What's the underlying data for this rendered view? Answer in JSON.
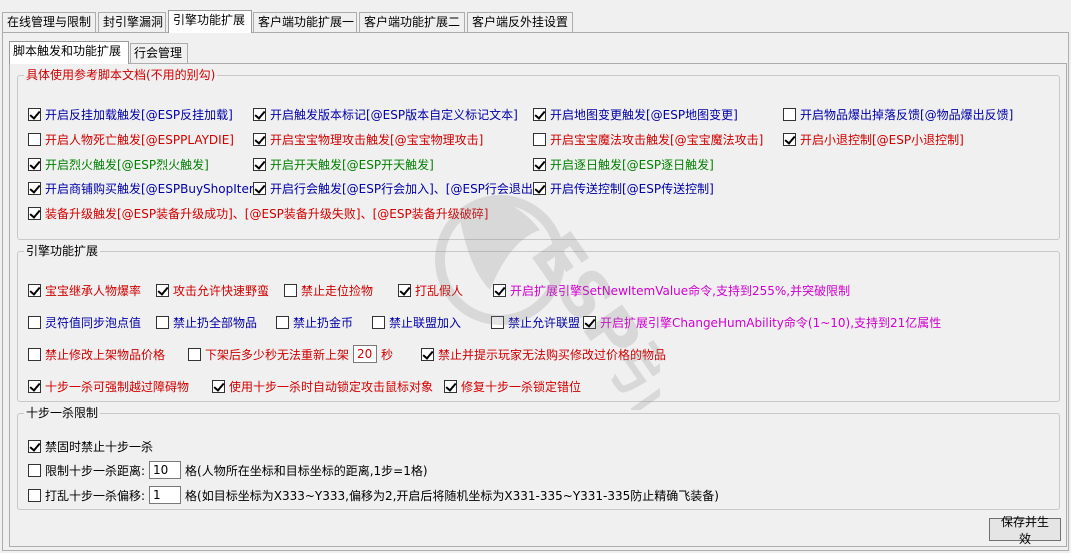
{
  "top_tabs": [
    "在线管理与限制",
    "封引擎漏洞",
    "引擎功能扩展",
    "客户端功能扩展一",
    "客户端功能扩展二",
    "客户端反外挂设置"
  ],
  "sub_tabs": [
    "脚本触发和功能扩展",
    "行会管理"
  ],
  "group1": {
    "title": "具体使用参考脚本文档(不用的别勾)",
    "items": [
      {
        "label": "开启反挂加载触发[@ESP反挂加载]",
        "checked": true,
        "color": "blue"
      },
      {
        "label": "开启触发版本标记[@ESP版本自定义标记文本]",
        "checked": true,
        "color": "blue"
      },
      {
        "label": "开启地图变更触发[@ESP地图变更]",
        "checked": true,
        "color": "blue"
      },
      {
        "label": "开启物品爆出掉落反馈[@物品爆出反馈]",
        "checked": false,
        "color": "blue"
      },
      {
        "label": "开启人物死亡触发[@ESPPLAYDIE]",
        "checked": false,
        "color": "red"
      },
      {
        "label": "开启宝宝物理攻击触发[@宝宝物理攻击]",
        "checked": true,
        "color": "red"
      },
      {
        "label": "开启宝宝魔法攻击触发[@宝宝魔法攻击]",
        "checked": false,
        "color": "red"
      },
      {
        "label": "开启小退控制[@ESP小退控制]",
        "checked": true,
        "color": "red"
      },
      {
        "label": "开启烈火触发[@ESP烈火触发]",
        "checked": true,
        "color": "green"
      },
      {
        "label": "开启开天触发[@ESP开天触发]",
        "checked": true,
        "color": "green"
      },
      {
        "label": "开启逐日触发[@ESP逐日触发]",
        "checked": true,
        "color": "green"
      },
      {
        "label": "开启商铺购买触发[@ESPBuyShopItem]",
        "checked": true,
        "color": "blue"
      },
      {
        "label": "开启行会触发[@ESP行会加入]、[@ESP行会退出]",
        "checked": true,
        "color": "blue"
      },
      {
        "label": "开启传送控制[@ESP传送控制]",
        "checked": true,
        "color": "blue"
      },
      {
        "label": "装备升级触发[@ESP装备升级成功]、[@ESP装备升级失败]、[@ESP装备升级破碎]",
        "checked": true,
        "color": "red"
      }
    ]
  },
  "group2": {
    "title": "引擎功能扩展",
    "items": [
      {
        "label": "宝宝继承人物爆率",
        "checked": true,
        "color": "red"
      },
      {
        "label": "攻击允许快速野蛮",
        "checked": true,
        "color": "red"
      },
      {
        "label": "禁止走位捡物",
        "checked": false,
        "color": "red"
      },
      {
        "label": "打乱假人",
        "checked": true,
        "color": "red"
      },
      {
        "label": "开启扩展引擎SetNewItemValue命令,支持到255%,并突破限制",
        "checked": true,
        "color": "magenta"
      },
      {
        "label": "灵符值同步泡点值",
        "checked": false,
        "color": "blue"
      },
      {
        "label": "禁止扔全部物品",
        "checked": false,
        "color": "blue"
      },
      {
        "label": "禁止扔金币",
        "checked": false,
        "color": "blue"
      },
      {
        "label": "禁止联盟加入",
        "checked": false,
        "color": "blue"
      },
      {
        "label": "禁止允许联盟",
        "checked": false,
        "color": "blue"
      },
      {
        "label": "开启扩展引擎ChangeHumAbility命令(1~10),支持到21亿属性",
        "checked": true,
        "color": "magenta"
      },
      {
        "label": "禁止修改上架物品价格",
        "checked": false,
        "color": "red"
      },
      {
        "label": "下架后多少秒无法重新上架",
        "checked": false,
        "color": "red",
        "value": "20",
        "suffix": "秒"
      },
      {
        "label": "禁止并提示玩家无法购买修改过价格的物品",
        "checked": true,
        "color": "red"
      },
      {
        "label": "十步一杀可强制越过障碍物",
        "checked": true,
        "color": "red"
      },
      {
        "label": "使用十步一杀时自动锁定攻击鼠标对象",
        "checked": true,
        "color": "red"
      },
      {
        "label": "修复十步一杀锁定错位",
        "checked": true,
        "color": "red"
      }
    ]
  },
  "group3": {
    "title": "十步一杀限制",
    "items": [
      {
        "label": "禁固时禁止十步一杀",
        "checked": true,
        "color": "black"
      },
      {
        "label": "限制十步一杀距离:",
        "checked": false,
        "color": "black",
        "value": "10",
        "suffix": "格(人物所在坐标和目标坐标的距离,1步=1格)"
      },
      {
        "label": "打乱十步一杀偏移:",
        "checked": false,
        "color": "black",
        "value": "1",
        "suffix": "格(如目标坐标为X333~Y333,偏移为2,开启后将随机坐标为X331-335~Y331-335防止精确飞装备)"
      }
    ]
  },
  "save_button": "保存并生效",
  "watermark_text": "ESP引擎"
}
